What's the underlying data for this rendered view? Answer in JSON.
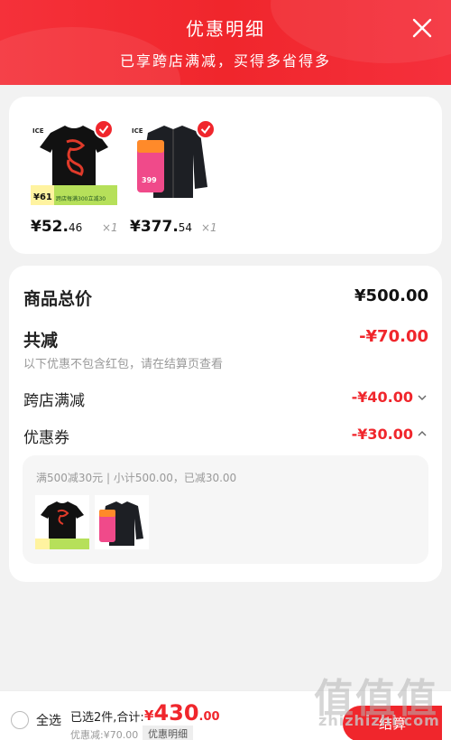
{
  "header": {
    "title": "优惠明细",
    "subtitle": "已享跨店满减，买得多省得多"
  },
  "products": [
    {
      "brand": "ICE",
      "product_type": "black t-shirt",
      "badge_price": "¥61",
      "badge_text": "跨店每满300立减30",
      "selected": true,
      "price_main": "¥52.",
      "price_dec": "46",
      "qty": "×1"
    },
    {
      "brand": "ICE",
      "product_type": "black jacket",
      "badge_price": "399",
      "badge_text": "",
      "selected": true,
      "price_main": "¥377.",
      "price_dec": "54",
      "qty": "×1"
    }
  ],
  "summary": {
    "total_label": "商品总价",
    "total_value": "¥500.00",
    "reduce_label": "共减",
    "reduce_value": "-¥70.00",
    "reduce_note": "以下优惠不包含红包，请在结算页查看",
    "cross_store_label": "跨店满减",
    "cross_store_value": "-¥40.00",
    "coupon_label": "优惠券",
    "coupon_value": "-¥30.00"
  },
  "coupon_detail": {
    "text": "满500减30元 | 小计500.00，已减30.00"
  },
  "bottom_bar": {
    "select_all": "全选",
    "selected_text": "已选2件,合计:",
    "currency": "¥",
    "total_int": "430",
    "total_dec": ".00",
    "discount_text": "优惠减:¥70.00",
    "detail_button": "优惠明细",
    "pay_button": "结算"
  },
  "watermark": {
    "main": "值值值",
    "site": "zhizhizhi.com"
  },
  "colors": {
    "accent": "#f0262c",
    "muted": "#999999"
  }
}
